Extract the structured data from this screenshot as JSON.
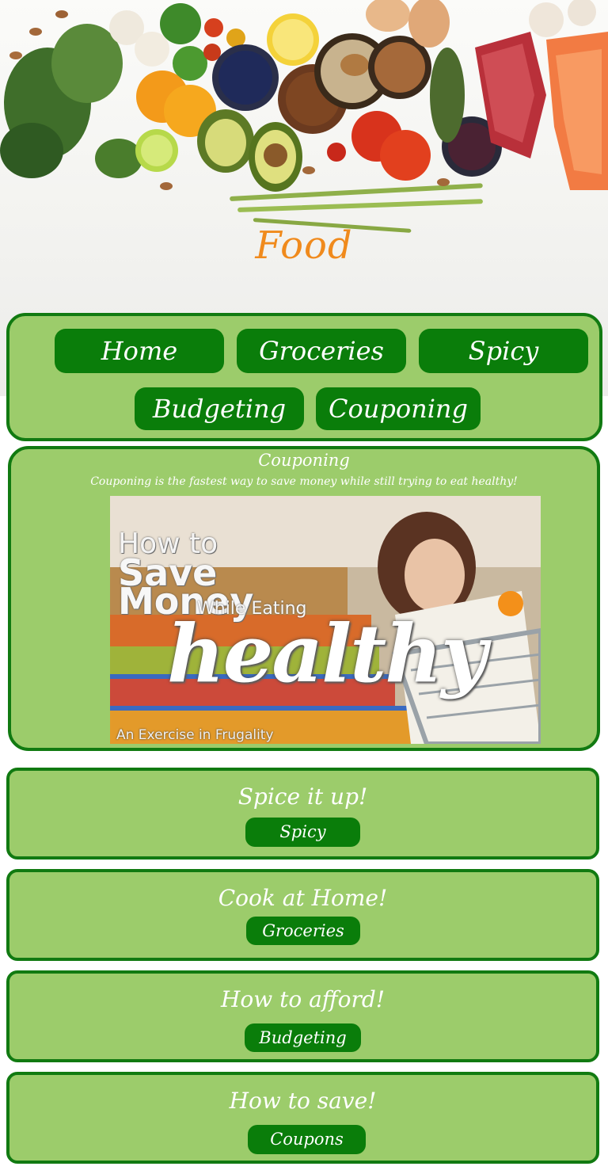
{
  "header": {
    "title": "Food"
  },
  "nav": {
    "items": [
      "Home",
      "Groceries",
      "Spicy",
      "Budgeting",
      "Couponing"
    ]
  },
  "feature": {
    "title": "Couponing",
    "text": "Couponing is the fastest way to save money while still trying to eat healthy!",
    "image": {
      "line1": "How to",
      "line2": "Save",
      "line3": "Money",
      "line4": "While Eating",
      "line5": "healthy",
      "line6": "An Exercise in Frugality"
    }
  },
  "cards": [
    {
      "title": "Spice it up!",
      "button": "Spicy"
    },
    {
      "title": "Cook at Home!",
      "button": "Groceries"
    },
    {
      "title": "How to afford!",
      "button": "Budgeting"
    },
    {
      "title": "How to save!",
      "button": "Coupons"
    }
  ],
  "colors": {
    "panel_green": "#9ccc6b",
    "border_green": "#117a11",
    "button_green": "#0a7d0a",
    "title_orange": "#f08a1c"
  }
}
